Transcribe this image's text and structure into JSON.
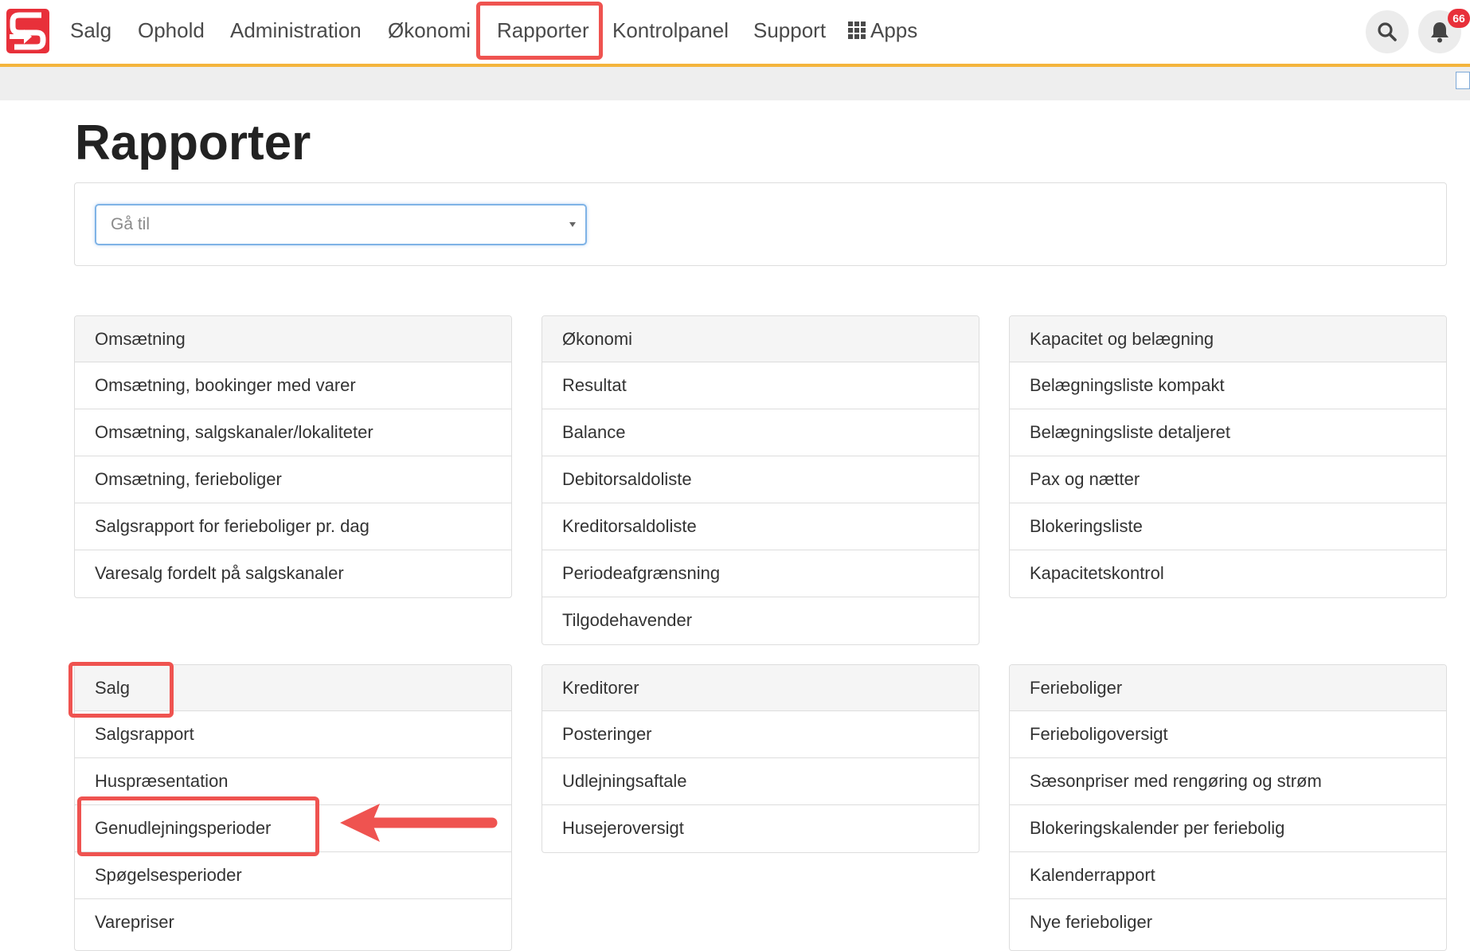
{
  "nav": {
    "items": [
      "Salg",
      "Ophold",
      "Administration",
      "Økonomi",
      "Rapporter",
      "Kontrolpanel",
      "Support"
    ],
    "apps_label": "Apps",
    "notification_count": "66",
    "active_item": "Rapporter"
  },
  "page": {
    "title": "Rapporter",
    "goto_placeholder": "Gå til"
  },
  "panels": [
    {
      "title": "Omsætning",
      "items": [
        "Omsætning, bookinger med varer",
        "Omsætning, salgskanaler/lokaliteter",
        "Omsætning, ferieboliger",
        "Salgsrapport for ferieboliger pr. dag",
        "Varesalg fordelt på salgskanaler"
      ]
    },
    {
      "title": "Økonomi",
      "items": [
        "Resultat",
        "Balance",
        "Debitorsaldoliste",
        "Kreditorsaldoliste",
        "Periodeafgrænsning",
        "Tilgodehavender"
      ]
    },
    {
      "title": "Kapacitet og belægning",
      "items": [
        "Belægningsliste kompakt",
        "Belægningsliste detaljeret",
        "Pax og nætter",
        "Blokeringsliste",
        "Kapacitetskontrol"
      ]
    },
    {
      "title": "Salg",
      "items": [
        "Salgsrapport",
        "Huspræsentation",
        "Genudlejningsperioder",
        "Spøgelsesperioder",
        "Varepriser"
      ]
    },
    {
      "title": "Kreditorer",
      "items": [
        "Posteringer",
        "Udlejningsaftale",
        "Husejeroversigt"
      ]
    },
    {
      "title": "Ferieboliger",
      "items": [
        "Ferieboligoversigt",
        "Sæsonpriser med rengøring og strøm",
        "Blokeringskalender per feriebolig",
        "Kalenderrapport",
        "Nye ferieboliger"
      ]
    }
  ],
  "colors": {
    "brand_red": "#e8303a",
    "nav_underline": "#f4b43c",
    "highlight": "#ef5350",
    "select_focus": "#7fb3e6"
  }
}
